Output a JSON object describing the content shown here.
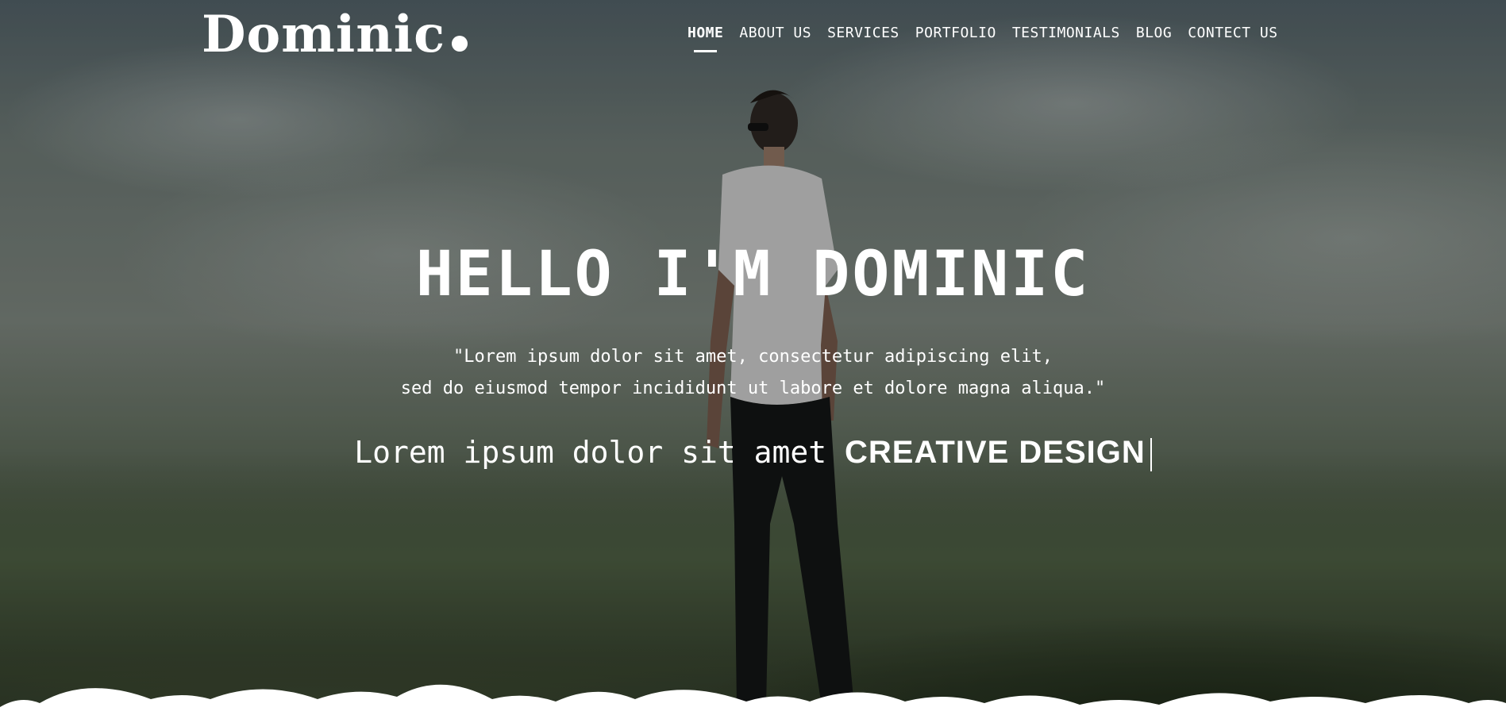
{
  "brand": {
    "name": "Dominic"
  },
  "nav": {
    "items": [
      {
        "label": "HOME",
        "active": true
      },
      {
        "label": "ABOUT US",
        "active": false
      },
      {
        "label": "SERVICES",
        "active": false
      },
      {
        "label": "PORTFOLIO",
        "active": false
      },
      {
        "label": "TESTIMONIALS",
        "active": false
      },
      {
        "label": "BLOG",
        "active": false
      },
      {
        "label": "CONTECT US",
        "active": false
      }
    ]
  },
  "hero": {
    "title": "HELLO I'M DOMINIC",
    "quote_line1": "\"Lorem ipsum dolor sit amet, consectetur adipiscing elit,",
    "quote_line2": "sed do eiusmod tempor incididunt ut labore et dolore magna aliqua.\"",
    "typed_prefix": "Lorem ipsum dolor sit amet",
    "typed_word": "CREATIVE DESIGN"
  },
  "colors": {
    "text": "#ffffff",
    "overlay": "#5d6a63"
  }
}
